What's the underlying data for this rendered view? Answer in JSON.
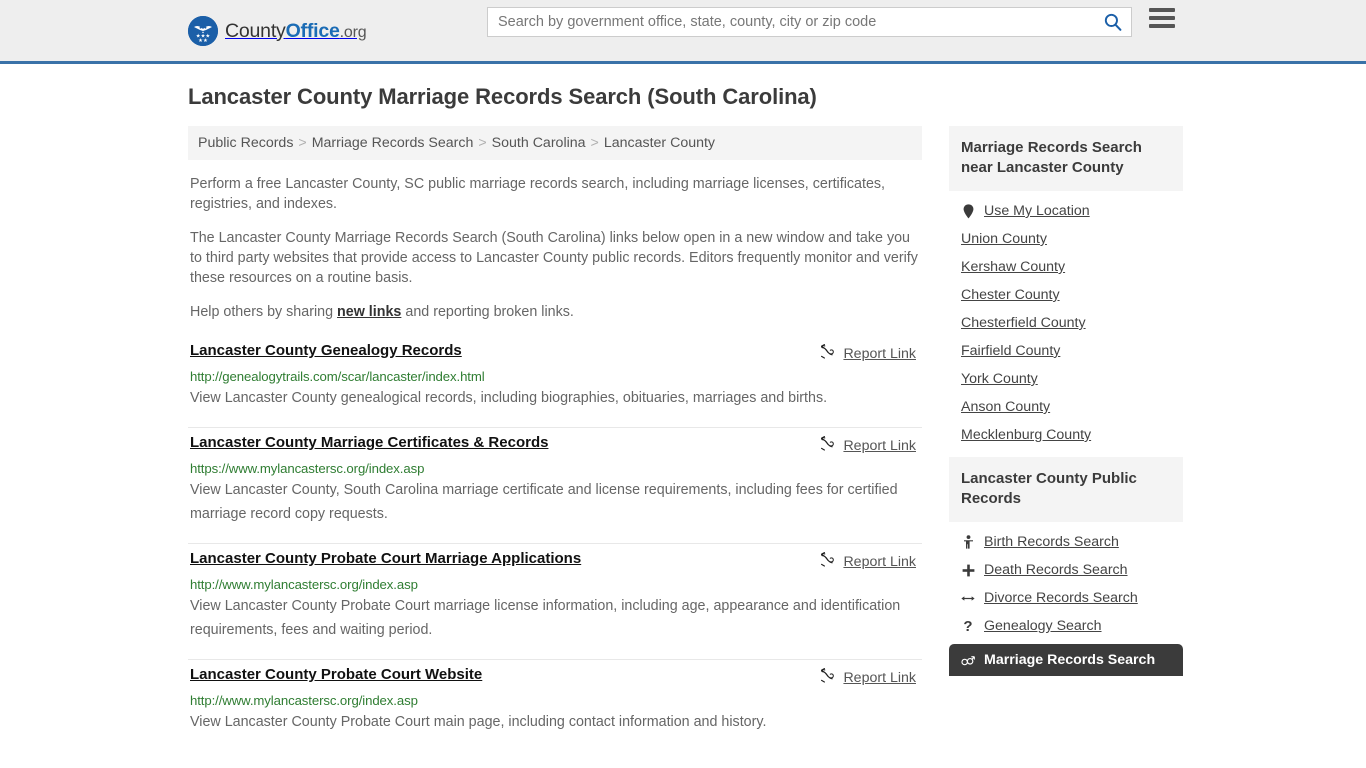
{
  "header": {
    "logo": {
      "icon": "eagle-seal-icon",
      "text_county": "County",
      "text_office": "Office",
      "text_org": ".org"
    },
    "search": {
      "placeholder": "Search by government office, state, county, city or zip code",
      "value": "",
      "icon": "search-icon"
    },
    "menu_icon": "hamburger-menu-icon"
  },
  "page_title": "Lancaster County Marriage Records Search (South Carolina)",
  "breadcrumb": {
    "separator": ">",
    "items": [
      {
        "label": "Public Records"
      },
      {
        "label": "Marriage Records Search"
      },
      {
        "label": "South Carolina"
      },
      {
        "label": "Lancaster County"
      }
    ]
  },
  "intro": {
    "p1": "Perform a free Lancaster County, SC public marriage records search, including marriage licenses, certificates, registries, and indexes.",
    "p2": "The Lancaster County Marriage Records Search (South Carolina) links below open in a new window and take you to third party websites that provide access to Lancaster County public records. Editors frequently monitor and verify these resources on a routine basis.",
    "p3_before": "Help others by sharing ",
    "p3_link": "new links",
    "p3_after": " and reporting broken links."
  },
  "report_link_label": "Report Link",
  "report_link_icon": "broken-link-icon",
  "results": [
    {
      "title": "Lancaster County Genealogy Records",
      "url": "http://genealogytrails.com/scar/lancaster/index.html",
      "description": "View Lancaster County genealogical records, including biographies, obituaries, marriages and births."
    },
    {
      "title": "Lancaster County Marriage Certificates & Records",
      "url": "https://www.mylancastersc.org/index.asp",
      "description": "View Lancaster County, South Carolina marriage certificate and license requirements, including fees for certified marriage record copy requests."
    },
    {
      "title": "Lancaster County Probate Court Marriage Applications",
      "url": "http://www.mylancastersc.org/index.asp",
      "description": "View Lancaster County Probate Court marriage license information, including age, appearance and identification requirements, fees and waiting period."
    },
    {
      "title": "Lancaster County Probate Court Website",
      "url": "http://www.mylancastersc.org/index.asp",
      "description": "View Lancaster County Probate Court main page, including contact information and history."
    }
  ],
  "sidebar": {
    "nearby": {
      "title": "Marriage Records Search near Lancaster County",
      "use_my_location": {
        "label": "Use My Location",
        "icon": "map-pin-icon"
      },
      "counties": [
        {
          "label": "Union County"
        },
        {
          "label": "Kershaw County"
        },
        {
          "label": "Chester County"
        },
        {
          "label": "Chesterfield County"
        },
        {
          "label": "Fairfield County"
        },
        {
          "label": "York County"
        },
        {
          "label": "Anson County"
        },
        {
          "label": "Mecklenburg County"
        }
      ]
    },
    "public_records": {
      "title": "Lancaster County Public Records",
      "items": [
        {
          "label": "Birth Records Search",
          "icon": "baby-icon",
          "glyph": "Ɣ",
          "active": false
        },
        {
          "label": "Death Records Search",
          "icon": "cross-icon",
          "glyph": "✚",
          "active": false
        },
        {
          "label": "Divorce Records Search",
          "icon": "left-right-arrow-icon",
          "glyph": "↔",
          "active": false
        },
        {
          "label": "Genealogy Search",
          "icon": "question-mark-icon",
          "glyph": "?",
          "active": false
        },
        {
          "label": "Marriage Records Search",
          "icon": "male-female-symbol-icon",
          "glyph": "⚤",
          "active": true
        }
      ]
    }
  },
  "colors": {
    "header_bg": "#eeeeee",
    "header_border": "#3a72a8",
    "brand_blue": "#1b6cb5",
    "url_green": "#2f7d32",
    "panel_gray": "#f4f4f4",
    "active_dark": "#3b3b3b"
  }
}
